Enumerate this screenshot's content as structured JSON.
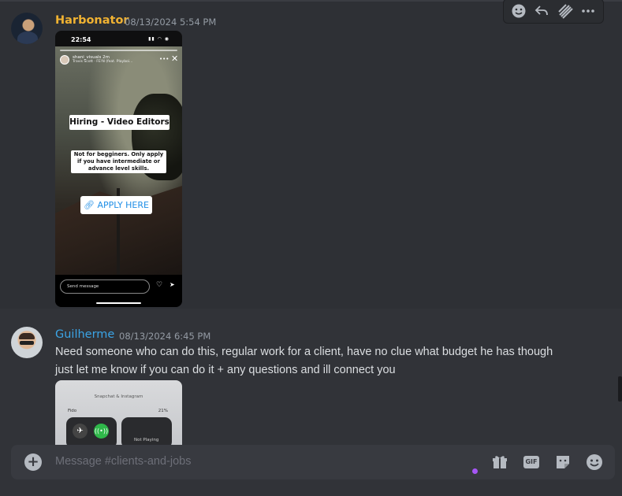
{
  "colors": {
    "background": "#313338",
    "username_1": "#f0b232",
    "username_2": "#3ba4e6",
    "timestamp": "#949ba4",
    "composer": "#383a40",
    "accent_dot": "#a656f5"
  },
  "toolbar": {
    "icons": [
      "add-reaction-icon",
      "reply-icon",
      "forward-icon",
      "more-icon"
    ]
  },
  "messages": [
    {
      "username": "Harbonator",
      "timestamp": "08/13/2024 5:54 PM",
      "attachment": {
        "status_time": "22:54",
        "story_user": "shani_visuals",
        "story_age": "2m",
        "story_song": "Travis Scott · FE!N (feat. Playboi...",
        "heading": "Hiring - Video Editors",
        "subtext": "Not for begginers. Only apply if you have intermediate or advance level skills.",
        "cta": "APPLY HERE",
        "send_placeholder": "Send message"
      }
    },
    {
      "username": "Guilherme",
      "timestamp": "08/13/2024 6:45 PM",
      "text": "Need someone who can do this, regular work for a client, have no clue what budget he has though just let me know if you can do it + any questions and ill connect you",
      "attachment": {
        "header": "Snapchat & Instagram",
        "carrier": "Fido",
        "battery": "21%",
        "now_playing": "Not Playing"
      }
    }
  ],
  "composer": {
    "placeholder": "Message #clients-and-jobs",
    "gif_label": "GIF",
    "icons": [
      "add-icon",
      "gift-icon",
      "gif-icon",
      "sticker-icon",
      "emoji-icon"
    ]
  }
}
